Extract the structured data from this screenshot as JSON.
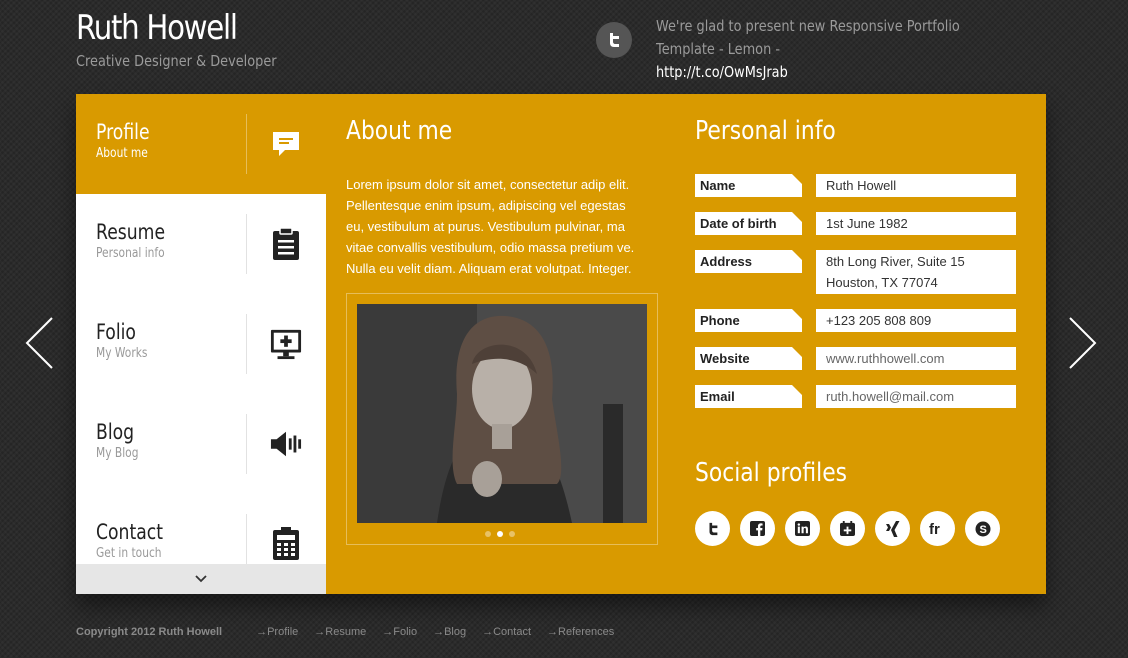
{
  "header": {
    "name": "Ruth Howell",
    "tagline": "Creative Designer & Developer",
    "tweet_text": "We're glad to present new Responsive Portfolio Template - Lemon -",
    "tweet_link": "http://t.co/OwMsJrab"
  },
  "sidebar": {
    "items": [
      {
        "title": "Profile",
        "subtitle": "About me",
        "icon": "comment-icon",
        "active": true
      },
      {
        "title": "Resume",
        "subtitle": "Personal info",
        "icon": "clipboard-icon",
        "active": false
      },
      {
        "title": "Folio",
        "subtitle": "My Works",
        "icon": "monitor-plus-icon",
        "active": false
      },
      {
        "title": "Blog",
        "subtitle": "My Blog",
        "icon": "speaker-icon",
        "active": false
      },
      {
        "title": "Contact",
        "subtitle": "Get in touch",
        "icon": "calculator-icon",
        "active": false
      }
    ]
  },
  "about": {
    "heading": "About me",
    "text": "Lorem ipsum dolor sit amet, consectetur adip elit. Pellentesque enim ipsum, adipiscing vel egestas eu, vestibulum at purus. Vestibulum pulvinar, ma vitae convallis vestibulum, odio massa pretium ve. Nulla eu velit diam. Aliquam erat volutpat. Integer.",
    "slider_active": 2,
    "slider_count": 3
  },
  "personal": {
    "heading": "Personal info",
    "rows": [
      {
        "label": "Name",
        "value": "Ruth Howell"
      },
      {
        "label": "Date of birth",
        "value": "1st June 1982"
      },
      {
        "label": "Address",
        "value": "8th Long River, Suite 15",
        "value2": "Houston, TX 77074"
      },
      {
        "label": "Phone",
        "value": "+123 205 808 809"
      },
      {
        "label": "Website",
        "value": "www.ruthhowell.com"
      },
      {
        "label": "Email",
        "value": "ruth.howell@mail.com"
      }
    ]
  },
  "social": {
    "heading": "Social profiles",
    "icons": [
      "twitter-icon",
      "facebook-icon",
      "linkedin-icon",
      "google-plus-icon",
      "xing-icon",
      "friendfeed-icon",
      "skype-icon"
    ]
  },
  "footer": {
    "copyright": "Copyright 2012 Ruth Howell",
    "links": [
      "Profile",
      "Resume",
      "Folio",
      "Blog",
      "Contact",
      "References"
    ]
  },
  "colors": {
    "accent": "#d99a00",
    "background": "#2b2b2b"
  }
}
